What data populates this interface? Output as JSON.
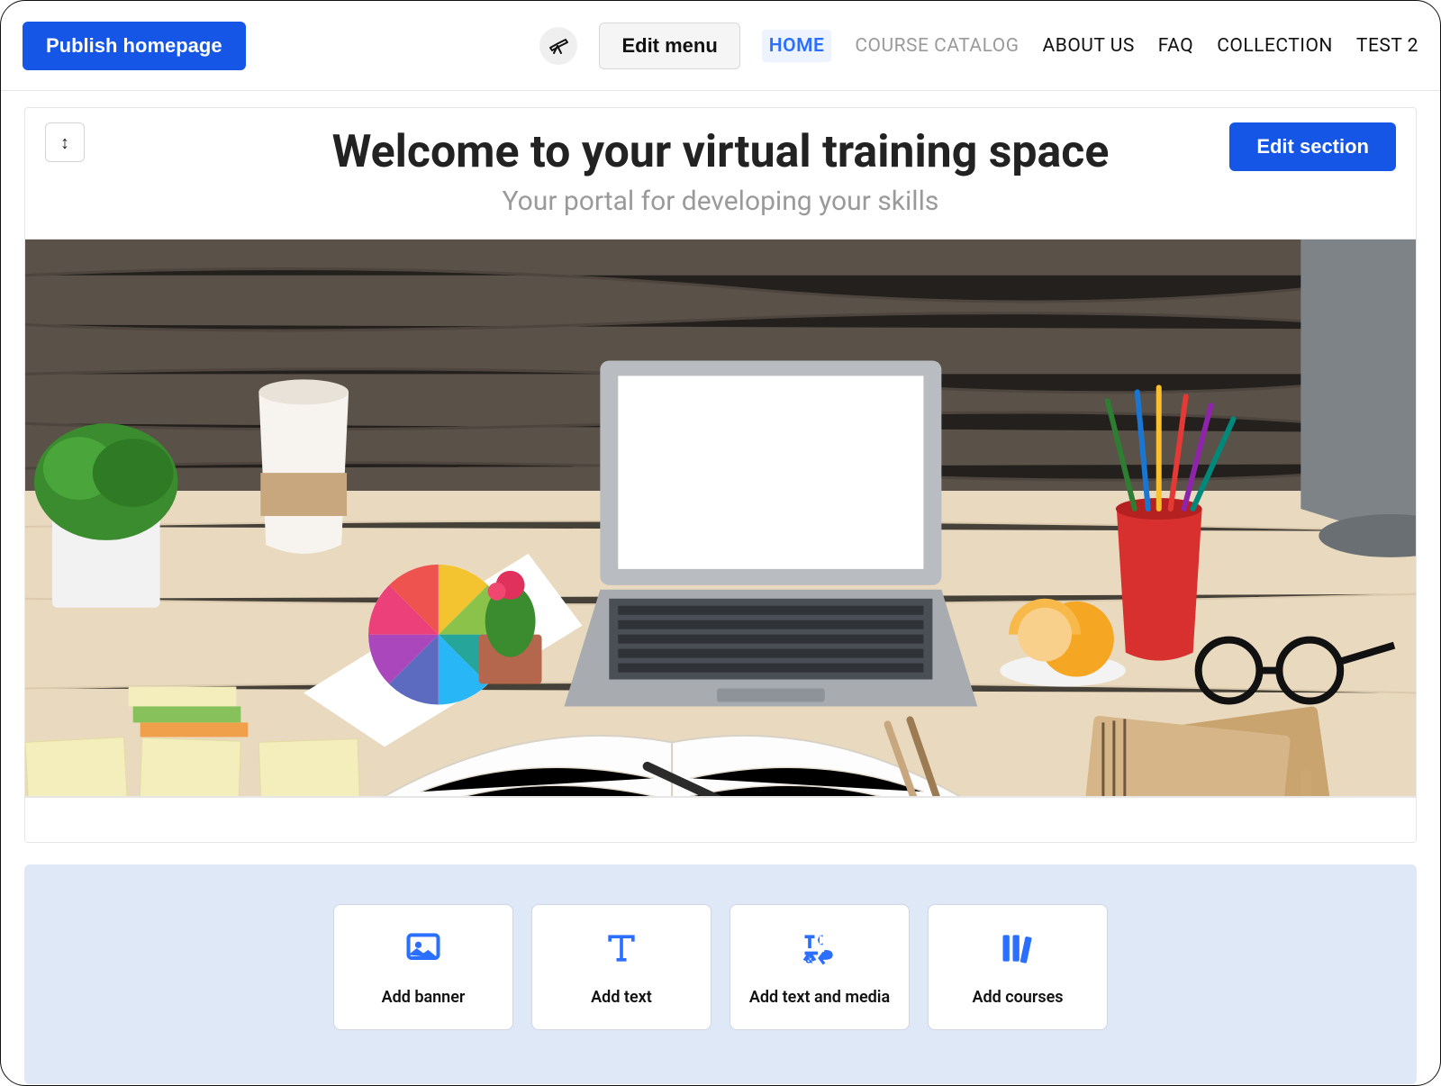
{
  "topbar": {
    "publish_label": "Publish homepage",
    "edit_menu_label": "Edit menu",
    "nav": [
      {
        "label": "HOME",
        "state": "active"
      },
      {
        "label": "COURSE CATALOG",
        "state": "muted"
      },
      {
        "label": "ABOUT US",
        "state": "normal"
      },
      {
        "label": "FAQ",
        "state": "normal"
      },
      {
        "label": "COLLECTION",
        "state": "normal"
      },
      {
        "label": "TEST 2",
        "state": "normal"
      }
    ]
  },
  "hero": {
    "reorder_glyph": "↕",
    "edit_section_label": "Edit section",
    "title": "Welcome to your virtual training space",
    "subtitle": "Your portal for developing your skills"
  },
  "add_section": {
    "cards": [
      {
        "icon": "image-icon",
        "label": "Add banner"
      },
      {
        "icon": "text-icon",
        "label": "Add text"
      },
      {
        "icon": "text-media-icon",
        "label": "Add text and media"
      },
      {
        "icon": "books-icon",
        "label": "Add courses"
      }
    ]
  },
  "colors": {
    "primary": "#1556e6",
    "accent_blue": "#2a6fff",
    "muted_text": "#9a9a9a",
    "panel_bg": "#dfe8f7"
  }
}
